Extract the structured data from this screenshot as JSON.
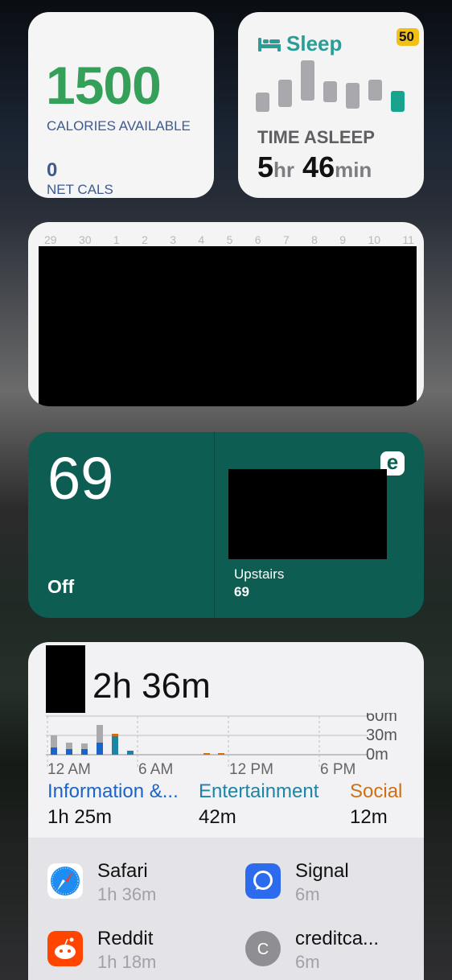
{
  "calories": {
    "available": "1500",
    "available_label": "CALORIES AVAILABLE",
    "net": "0",
    "net_label": "NET CALS",
    "color": "#34a05a"
  },
  "sleep": {
    "title": "Sleep",
    "badge": "50",
    "label": "TIME ASLEEP",
    "hours": "5",
    "hours_unit": "hr",
    "minutes": "46",
    "minutes_unit": "min",
    "accent": "#2a9d96"
  },
  "calendar": {
    "days": [
      "29",
      "30",
      "1",
      "2",
      "3",
      "4",
      "5",
      "6",
      "7",
      "8",
      "9",
      "10",
      "11"
    ]
  },
  "thermostat": {
    "temperature": "69",
    "mode": "Off",
    "room_name": "Upstairs",
    "room_temp": "69",
    "icon": "ecobee-e-icon",
    "background": "#0d5d52"
  },
  "screen_time": {
    "total": "2h 36m",
    "axis_y": [
      "60m",
      "30m",
      "0m"
    ],
    "axis_x": [
      "12 AM",
      "6 AM",
      "12 PM",
      "6 PM"
    ],
    "categories": [
      {
        "name": "Information &...",
        "value": "1h 25m",
        "color": "#1a64c8"
      },
      {
        "name": "Entertainment",
        "value": "42m",
        "color": "#1d84a6"
      },
      {
        "name": "Social",
        "value": "12m",
        "color": "#d06f12"
      }
    ],
    "apps": [
      {
        "name": "Safari",
        "time": "1h 36m",
        "icon": "safari-icon"
      },
      {
        "name": "Signal",
        "time": "6m",
        "icon": "signal-icon"
      },
      {
        "name": "Reddit",
        "time": "1h 18m",
        "icon": "reddit-icon"
      },
      {
        "name": "creditca...",
        "time": "6m",
        "icon": "letter-c-icon",
        "icon_letter": "C"
      }
    ]
  }
}
